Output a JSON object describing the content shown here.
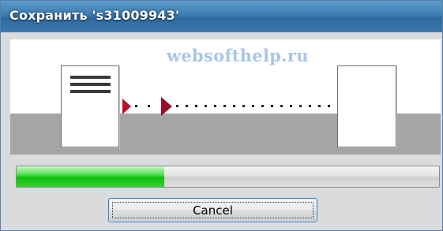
{
  "window": {
    "title": "Сохранить 's31009943'"
  },
  "animation": {
    "watermark": "websofthelp.ru",
    "source_icon": "document-with-lines-icon",
    "target_icon": "blank-document-icon",
    "arrow_icon": "red-triangle-arrow-icon",
    "arrow_color": "#b8102a"
  },
  "progress": {
    "value_fraction": 0.35,
    "fill_color": "#12c012"
  },
  "buttons": {
    "cancel_label": "Cancel"
  }
}
